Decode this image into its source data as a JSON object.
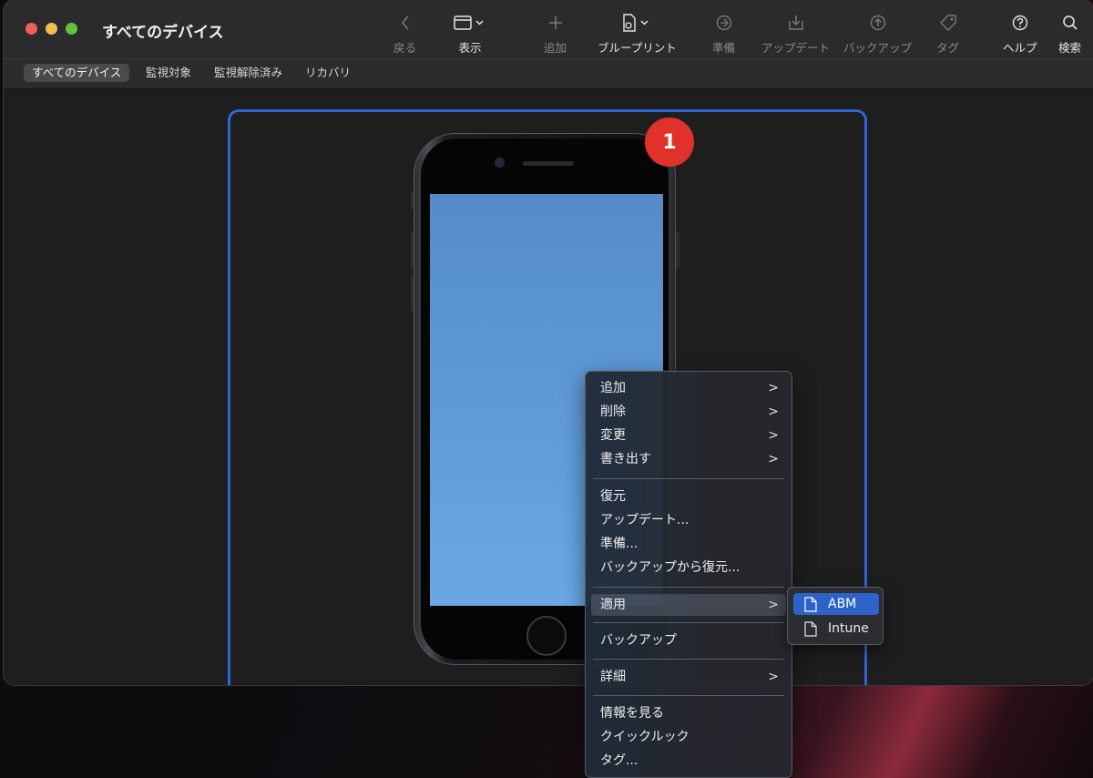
{
  "window": {
    "title": "すべてのデバイス"
  },
  "toolbar": {
    "back": "戻る",
    "view": "表示",
    "add": "追加",
    "blueprint": "ブループリント",
    "prepare": "準備",
    "update": "アップデート",
    "backup": "バックアップ",
    "tag": "タグ",
    "help": "ヘルプ",
    "search": "検索"
  },
  "tabs": [
    "すべてのデバイス",
    "監視対象",
    "監視解除済み",
    "リカバリ"
  ],
  "device": {
    "badge_count": "1"
  },
  "context_menu": {
    "items": [
      {
        "label": "追加",
        "submenu": true
      },
      {
        "label": "削除",
        "submenu": true
      },
      {
        "label": "変更",
        "submenu": true
      },
      {
        "label": "書き出す",
        "submenu": true
      },
      {
        "label": "復元",
        "submenu": false
      },
      {
        "label": "アップデート...",
        "submenu": false
      },
      {
        "label": "準備...",
        "submenu": false
      },
      {
        "label": "バックアップから復元...",
        "submenu": false
      },
      {
        "label": "適用",
        "submenu": true,
        "highlighted": true
      },
      {
        "label": "バックアップ",
        "submenu": false
      },
      {
        "label": "詳細",
        "submenu": true
      },
      {
        "label": "情報を見る",
        "submenu": false
      },
      {
        "label": "クイックルック",
        "submenu": false
      },
      {
        "label": "タグ...",
        "submenu": false
      }
    ],
    "chevron": ">"
  },
  "apply_submenu": {
    "items": [
      {
        "label": "ABM",
        "selected": true
      },
      {
        "label": "Intune",
        "selected": false
      }
    ]
  },
  "colors": {
    "accent": "#2f66d6",
    "badge": "#e0322b",
    "selection": "#2d63c8"
  }
}
